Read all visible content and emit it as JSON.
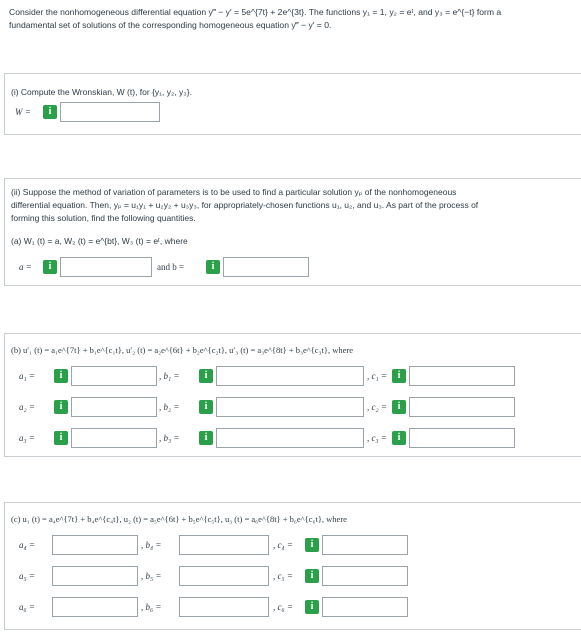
{
  "intro": {
    "line1": "Consider the nonhomogeneous differential equation y‴ − y′ = 5e^{7t} + 2e^{3t}. The functions y₁ = 1, y₂ = eᵗ, and y₃ = e^{−t} form a",
    "line2": "fundamental set of solutions of the corresponding homogeneous equation y‴ − y′ = 0."
  },
  "part_i": {
    "prompt": "(i) Compute the Wronskian, W (t), for {y₁, y₂, y₃}.",
    "w_label": "W  =",
    "w_value": ""
  },
  "part_ii": {
    "line1": "(ii) Suppose the method of variation of parameters is to be used to find a particular solution yₚ of the nonhomogeneous",
    "line2": "differential equation. Then, yₚ = u₁y₁ + u₂y₂ + u₃y₃, for appropriately-chosen functions u₁, u₂, and u₃. As part of the process of",
    "line3": "forming this solution, find the following quantities.",
    "a_line": "(a) W₁ (t) = a,  W₂ (t) = e^{bt},  W₃ (t) = eᵗ, where",
    "a_label": "a  =",
    "a_value": "",
    "b_label": "and b  =",
    "b_value": ""
  },
  "part_b": {
    "header": "(b) u′₁ (t) = a₁e^{7t} + b₁e^{c₁t},  u′₂ (t) = a₂e^{6t} + b₂e^{c₂t},  u′₃ (t) = a₃e^{8t} + b₃e^{c₃t}, where",
    "rows": [
      {
        "a": "a₁  =",
        "b": ", b₁  =",
        "c": ", c₁  ="
      },
      {
        "a": "a₂  =",
        "b": ", b₂  =",
        "c": ", c₂  ="
      },
      {
        "a": "a₃  =",
        "b": ", b₃  =",
        "c": ", c₃  ="
      }
    ]
  },
  "part_c": {
    "header": "(c) u₁ (t) = a₄e^{7t} + b₄e^{c₄t},  u₂ (t) = a₅e^{6t} + b₅e^{c₅t},  u₃ (t) = a₆e^{8t} + b₆e^{c₆t}, where",
    "rows": [
      {
        "a": "a₄  =",
        "b": ", b₄  =",
        "c": ", c₄  ="
      },
      {
        "a": "a₅  =",
        "b": ", b₅  =",
        "c": ", c₅  ="
      },
      {
        "a": "a₆  =",
        "b": ", b₆  =",
        "c": ", c₆  ="
      }
    ]
  },
  "info_glyph": "i",
  "colors": {
    "info_badge": "#2b9f4a",
    "input_border": "#9aa3a9",
    "panel_border": "#c7cdd1"
  }
}
